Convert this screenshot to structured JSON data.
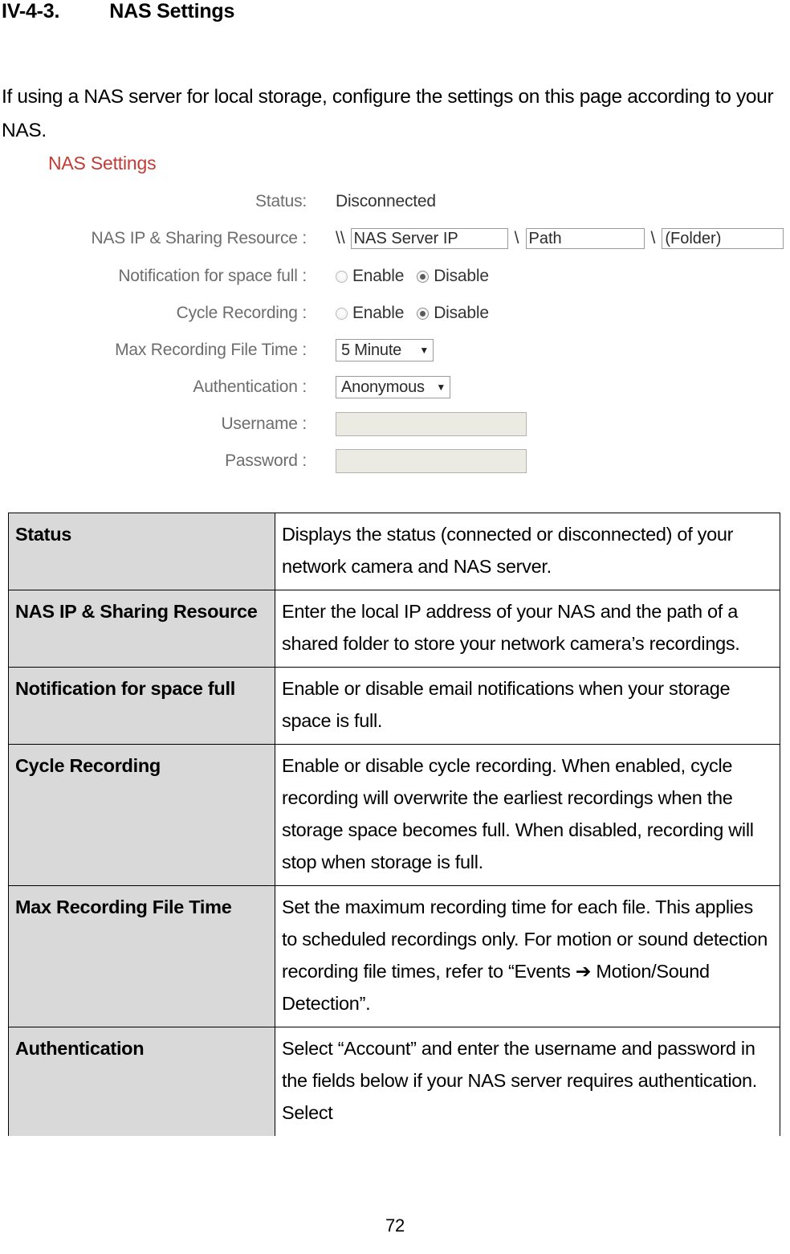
{
  "heading": {
    "number": "IV-4-3.",
    "title": "NAS Settings"
  },
  "intro": "If using a NAS server for local storage, configure the settings on this page according to your NAS.",
  "screenshot": {
    "panel_title": "NAS Settings",
    "accent_color": "#c33b34",
    "label_color": "#6d6d6d",
    "fields": {
      "status": {
        "label": "Status:",
        "value": "Disconnected"
      },
      "nas_ip": {
        "label": "NAS IP & Sharing Resource :",
        "prefix": "\\\\",
        "separator_1": "\\",
        "separator_2": "\\",
        "server_ip_value": "NAS Server IP",
        "path_value": "Path",
        "folder_value": "(Folder)"
      },
      "notification": {
        "label": "Notification for space full :",
        "enable_label": "Enable",
        "disable_label": "Disable",
        "selected": "Disable"
      },
      "cycle_recording": {
        "label": "Cycle Recording :",
        "enable_label": "Enable",
        "disable_label": "Disable",
        "selected": "Disable"
      },
      "max_recording_file_time": {
        "label": "Max Recording File Time :",
        "value": "5 Minute",
        "caret": "▼"
      },
      "authentication": {
        "label": "Authentication :",
        "value": "Anonymous",
        "caret": "▼"
      },
      "username": {
        "label": "Username :",
        "value": ""
      },
      "password": {
        "label": "Password :",
        "value": ""
      }
    }
  },
  "table": {
    "rows": [
      {
        "key": "Status",
        "value": "Displays the status (connected or disconnected) of your network camera and NAS server."
      },
      {
        "key": "NAS IP & Sharing Resource",
        "value": "Enter the local IP address of your NAS and the path of a shared folder to store your network camera’s recordings."
      },
      {
        "key": "Notification for space full",
        "value": "Enable or disable email notifications when your storage space is full."
      },
      {
        "key": "Cycle Recording",
        "value": "Enable or disable cycle recording. When enabled, cycle recording will overwrite the earliest recordings when the storage space becomes full. When disabled, recording will stop when storage is full."
      },
      {
        "key": "Max Recording File Time",
        "value": "Set the maximum recording time for each file. This applies to scheduled recordings only. For motion or sound detection recording file times, refer to “Events ➔ Motion/Sound Detection”."
      },
      {
        "key": "Authentication",
        "value": "Select “Account” and enter the username and password in the fields below if your NAS server requires authentication. Select"
      }
    ]
  },
  "page_number": "72"
}
